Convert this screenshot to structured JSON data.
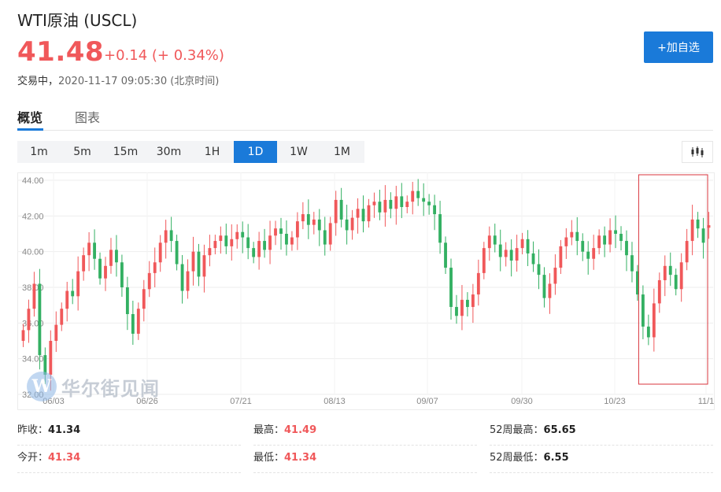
{
  "header": {
    "title": "WTI原油  (USCL)",
    "price": "41.48",
    "change": "+0.14 (+ 0.34%)",
    "status_label": "交易中，",
    "timestamp": "2020-11-17 09:05:30 (北京时间)",
    "add_button": "+加自选"
  },
  "tabs": [
    {
      "label": "概览",
      "active": true
    },
    {
      "label": "图表",
      "active": false
    }
  ],
  "ranges": [
    {
      "label": "1m"
    },
    {
      "label": "5m"
    },
    {
      "label": "15m"
    },
    {
      "label": "30m"
    },
    {
      "label": "1H"
    },
    {
      "label": "1D",
      "active": true
    },
    {
      "label": "1W"
    },
    {
      "label": "1M"
    }
  ],
  "watermark": {
    "mark": "W",
    "text": "华尔街见闻"
  },
  "stats": {
    "prev_close_label": "昨收：",
    "prev_close": "41.34",
    "high_label": "最高：",
    "high": "41.49",
    "wk52_high_label": "52周最高：",
    "wk52_high": "65.65",
    "open_label": "今开：",
    "open": "41.34",
    "low_label": "最低：",
    "low": "41.34",
    "wk52_low_label": "52周最低：",
    "wk52_low": "6.55"
  },
  "colors": {
    "up": "#f0585a",
    "down": "#33b062",
    "accent": "#1a7ad9",
    "highlight_box": "#d9363e"
  },
  "chart_data": {
    "type": "candlestick",
    "y_ticks": [
      "44.00",
      "42.00",
      "40.00",
      "38.00",
      "36.00",
      "34.00",
      "32.00"
    ],
    "ylim": [
      32,
      44
    ],
    "x_ticks": [
      "06/03",
      "06/26",
      "07/21",
      "08/13",
      "09/07",
      "09/30",
      "10/23",
      "11/1"
    ],
    "grid": true,
    "highlight": {
      "from_index": 113,
      "to_index": 124
    },
    "closes": [
      35.6,
      36.8,
      38.2,
      34.2,
      33.1,
      35.0,
      35.9,
      36.8,
      37.8,
      37.5,
      38.9,
      39.8,
      40.5,
      39.6,
      38.5,
      39.2,
      40.1,
      39.4,
      38.0,
      36.5,
      35.4,
      36.8,
      37.9,
      38.8,
      39.4,
      40.5,
      41.2,
      40.6,
      39.3,
      37.8,
      38.9,
      40.0,
      38.6,
      39.8,
      40.2,
      40.6,
      40.9,
      40.3,
      40.7,
      41.1,
      40.8,
      40.2,
      39.7,
      40.6,
      40.1,
      40.9,
      41.3,
      41.0,
      40.4,
      40.8,
      41.7,
      42.1,
      41.5,
      41.8,
      41.2,
      40.4,
      41.6,
      42.9,
      41.8,
      41.2,
      41.9,
      42.4,
      41.7,
      42.6,
      42.8,
      42.2,
      42.9,
      42.4,
      43.1,
      42.5,
      42.8,
      43.4,
      43.0,
      42.8,
      42.6,
      42.1,
      40.5,
      39.1,
      36.9,
      36.4,
      37.3,
      36.9,
      37.6,
      38.8,
      40.2,
      40.9,
      40.4,
      39.7,
      40.1,
      39.5,
      40.2,
      40.7,
      39.9,
      39.3,
      38.7,
      37.4,
      38.2,
      39.1,
      40.3,
      40.8,
      41.1,
      40.6,
      40.0,
      39.6,
      40.2,
      40.9,
      40.4,
      41.2,
      41.0,
      40.6,
      39.8,
      38.9,
      37.6,
      35.8,
      35.2,
      37.1,
      38.4,
      39.2,
      38.7,
      37.9,
      39.4,
      40.6,
      41.8,
      41.3,
      40.5,
      41.48
    ],
    "opens": [
      35.0,
      35.6,
      36.8,
      38.2,
      34.2,
      33.1,
      35.0,
      35.9,
      36.8,
      37.8,
      37.5,
      38.9,
      39.8,
      40.5,
      39.6,
      38.5,
      39.2,
      40.1,
      39.4,
      38.0,
      36.5,
      35.4,
      36.8,
      37.9,
      38.8,
      39.4,
      40.5,
      41.2,
      40.6,
      39.3,
      37.8,
      38.9,
      40.0,
      38.6,
      39.8,
      40.2,
      40.6,
      40.9,
      40.3,
      40.7,
      41.1,
      40.8,
      40.2,
      39.7,
      40.6,
      40.1,
      40.9,
      41.3,
      41.0,
      40.4,
      40.8,
      41.7,
      42.1,
      41.5,
      41.8,
      41.2,
      40.4,
      41.6,
      42.9,
      41.8,
      41.2,
      41.9,
      42.4,
      41.7,
      42.6,
      42.8,
      42.2,
      42.9,
      42.4,
      43.1,
      42.5,
      42.8,
      43.4,
      43.0,
      42.8,
      42.6,
      42.1,
      40.5,
      39.1,
      36.9,
      36.4,
      37.3,
      36.9,
      37.6,
      38.8,
      40.2,
      40.9,
      40.4,
      39.7,
      40.1,
      39.5,
      40.2,
      40.7,
      39.9,
      39.3,
      38.7,
      37.4,
      38.2,
      39.1,
      40.3,
      40.8,
      41.1,
      40.6,
      40.0,
      39.6,
      40.2,
      40.9,
      40.4,
      41.2,
      41.0,
      40.6,
      39.8,
      38.9,
      37.6,
      35.8,
      35.2,
      37.1,
      38.4,
      39.2,
      38.7,
      37.9,
      39.4,
      40.6,
      41.8,
      41.3,
      41.34
    ]
  }
}
